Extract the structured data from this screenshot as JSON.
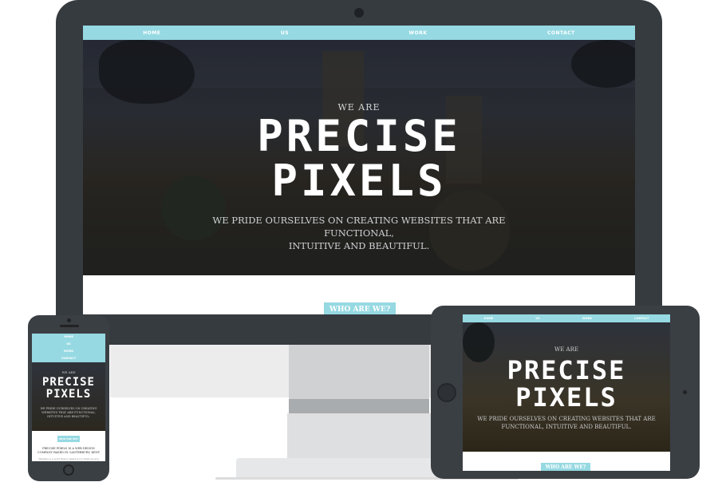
{
  "nav": {
    "items": [
      "HOME",
      "US",
      "WORK",
      "CONTACT"
    ]
  },
  "hero": {
    "intro": "WE ARE",
    "title_line1": "PRECISE",
    "title_line2": "PIXELS",
    "tagline_line1": "WE PRIDE OURSELVES ON CREATING WEBSITES THAT ARE FUNCTIONAL,",
    "tagline_line2": "INTUITIVE AND BEAUTIFUL."
  },
  "cta": {
    "label": "WHO ARE WE?"
  },
  "phone": {
    "tagline": "WE PRIDE OURSELVES ON CREATING WEBSITES THAT ARE FUNCTIONAL, INTUITIVE AND BEAUTIFUL.",
    "cta_label": "WHO ARE WE?",
    "about": "PRECISE PIXELS IS A WEB DESIGN COMPANY BASED IN CANTERBURY, KENT",
    "about_sub": "Website is a word that is heard a lot when we are"
  },
  "tablet": {
    "tagline_line1": "WE PRIDE OURSELVES ON CREATING WEBSITES THAT ARE",
    "tagline_line2": "FUNCTIONAL, INTUITIVE AND BEAUTIFUL.",
    "cta_label": "WHO ARE WE?"
  },
  "colors": {
    "accent": "#96d9e2",
    "device_frame": "#363b40"
  }
}
